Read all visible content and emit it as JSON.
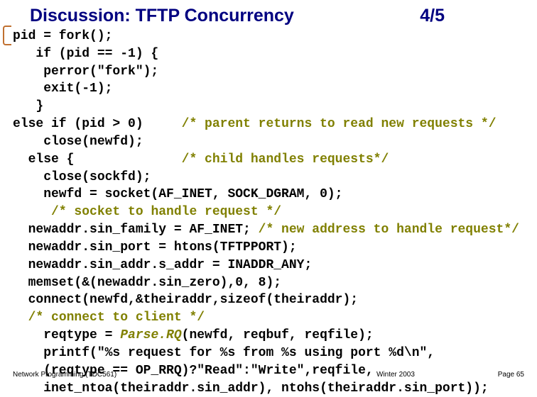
{
  "header": {
    "title": "Discussion: TFTP Concurrency",
    "page": "4/5"
  },
  "code": {
    "l01a": "pid = fork();",
    "l02a": "   if (pid == -1) {",
    "l03a": "    perror(\"fork\");",
    "l04a": "    exit(-1);",
    "l05a": "   }",
    "l06a": "else if (pid > 0)     ",
    "l06b": "/* parent returns to read new requests */",
    "l07a": "    close(newfd);",
    "l08a": "  else {              ",
    "l08b": "/* child handles requests*/",
    "l09a": "    close(sockfd);",
    "l10a": "    newfd = socket(AF_INET, SOCK_DGRAM, 0);",
    "l11a": "     ",
    "l11b": "/* socket to handle request */",
    "l12a": "  newaddr.sin_family = AF_INET; ",
    "l12b": "/* new address to handle request*/",
    "l13a": "  newaddr.sin_port = htons(TFTPPORT);",
    "l14a": "  newaddr.sin_addr.s_addr = INADDR_ANY;",
    "l15a": "  memset(&(newaddr.sin_zero),0, 8);",
    "l16a": "  connect(newfd,&theiraddr,sizeof(theiraddr);",
    "l17a": "  ",
    "l17b": "/* connect to client */",
    "l18a": "    reqtype = ",
    "l18b": "Parse.RQ",
    "l18c": "(newfd, reqbuf, reqfile);",
    "l19a": "    printf(\"%s request for %s from %s using port %d\\n\",",
    "l20a": "    (reqtype == OP_RRQ)?\"Read\":\"Write\",reqfile,",
    "l21a": "    inet_ntoa(theiraddr.sin_addr), ntohs(theiraddr.sin_port));"
  },
  "footer": {
    "left": "Network Programming (TDC561)",
    "mid": "Winter 2003",
    "right": "Page 65"
  }
}
